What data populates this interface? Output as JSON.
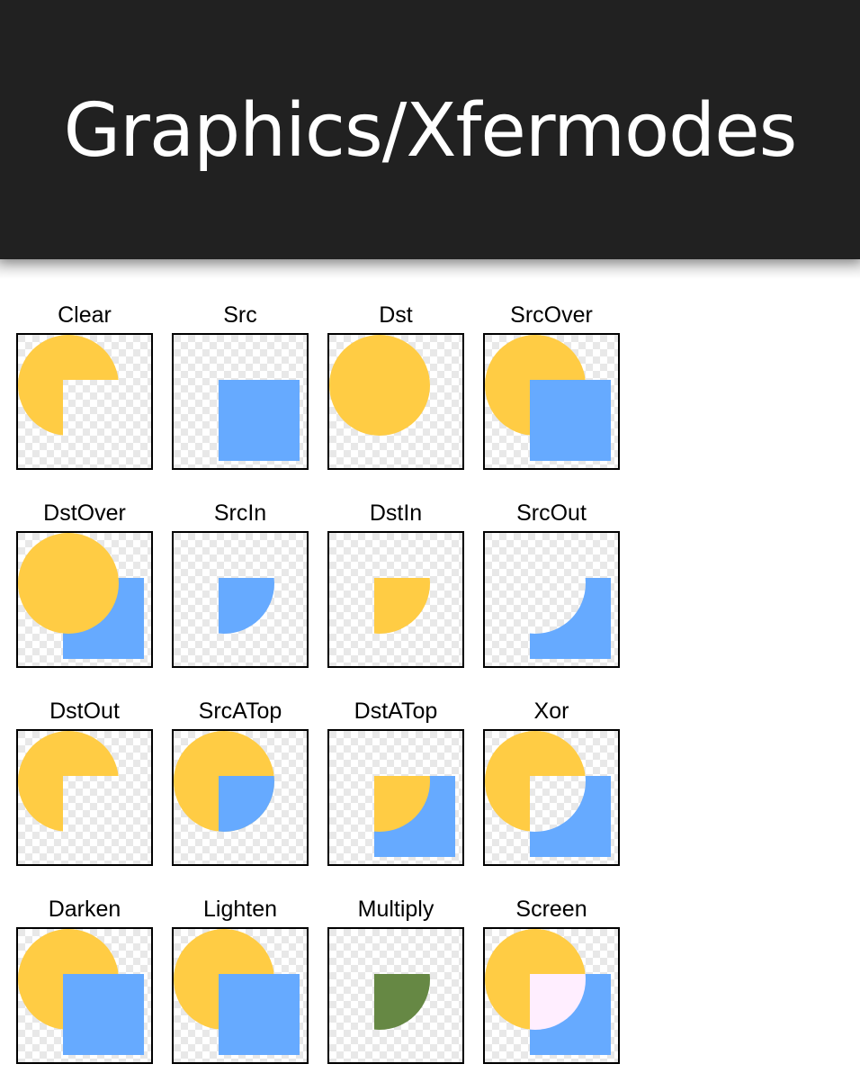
{
  "app_bar": {
    "title": "Graphics/Xfermodes"
  },
  "colors": {
    "app_bar_bg": "#212121",
    "circle_yellow": "#FFCC44",
    "square_blue": "#66AAFF",
    "multiply_green": "#668844",
    "screen_pink": "#FFEEFF",
    "checker_light": "#FFFFFF",
    "checker_dark": "#E8E8E8"
  },
  "modes": [
    {
      "label": "Clear"
    },
    {
      "label": "Src"
    },
    {
      "label": "Dst"
    },
    {
      "label": "SrcOver"
    },
    {
      "label": "DstOver"
    },
    {
      "label": "SrcIn"
    },
    {
      "label": "DstIn"
    },
    {
      "label": "SrcOut"
    },
    {
      "label": "DstOut"
    },
    {
      "label": "SrcATop"
    },
    {
      "label": "DstATop"
    },
    {
      "label": "Xor"
    },
    {
      "label": "Darken"
    },
    {
      "label": "Lighten"
    },
    {
      "label": "Multiply"
    },
    {
      "label": "Screen"
    }
  ]
}
